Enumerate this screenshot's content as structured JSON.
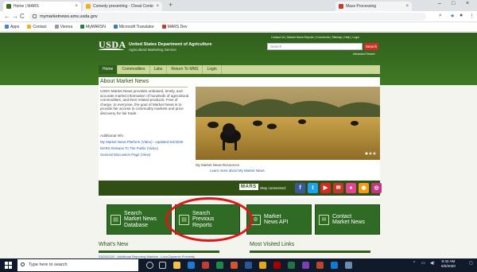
{
  "browser": {
    "tabs": [
      {
        "label": "Home | MARS",
        "close": "×"
      },
      {
        "label": "Comedy presenting - Cheat Content",
        "close": "×"
      },
      {
        "label": "Mass Processing",
        "close": "×"
      }
    ],
    "new_tab": "+",
    "window_controls": [
      "–",
      "□",
      "×"
    ],
    "nav": {
      "back": "←",
      "forward": "→",
      "reload": "C"
    },
    "url": "mymarketnews.ams.usda.gov",
    "bookmarks": [
      "Apps",
      "Contact",
      "Vienna",
      "MyMARSN",
      "Microsoft Translator",
      "MARS Dev"
    ]
  },
  "site": {
    "logo": "USDA",
    "department": "United States Department of Agriculture",
    "agency": "Agricultural Marketing Service",
    "top_links": "Contact Us | Market News Reports | Comments | Sitemap | Help | Login",
    "search_placeholder": "Search",
    "search_button": "Search",
    "advanced_search": "Advanced Search",
    "menu": [
      "Home",
      "Commodities",
      "Labs",
      "Return To MNS",
      "Login"
    ]
  },
  "about": {
    "title": "About Market News",
    "text": "USDA Market News provides unbiased, timely, and accurate market information of hundreds of agricultural commodities, and their related products. Free of charge, to everyone, the goal of Market News is to provide fair access to commodity markets and price discovery for fair trade.",
    "additional_info": "Additional Info",
    "links": [
      "My Market News Platform (Video) - Updated 5/4/2020",
      "MARS Release To The Public (Video)",
      "General Discussion Page (View)"
    ]
  },
  "hero": {
    "caption": "My Market News Resources",
    "link": "Learn more about My Market News"
  },
  "connected": {
    "mars_logo": "MARS",
    "label": "Stay connected:",
    "social": [
      {
        "name": "facebook-icon",
        "glyph": "f",
        "color": "#3b5998"
      },
      {
        "name": "twitter-icon",
        "glyph": "t",
        "color": "#1da1f2"
      },
      {
        "name": "youtube-icon",
        "glyph": "▶",
        "color": "#d62b22"
      },
      {
        "name": "email-icon",
        "glyph": "✉",
        "color": "#c0392b"
      },
      {
        "name": "flickr-icon",
        "glyph": "●",
        "color": "#e84393"
      },
      {
        "name": "rss-icon",
        "glyph": "◉",
        "color": "#f39c12"
      },
      {
        "name": "instagram-icon",
        "glyph": "◎",
        "color": "#c13584"
      }
    ]
  },
  "actions": [
    {
      "line1": "Search",
      "line2": "Market News",
      "line3": "Database",
      "icon": "▤"
    },
    {
      "line1": "Search",
      "line2": "Previous",
      "line3": "Reports",
      "icon": "▤"
    },
    {
      "line1": "Market",
      "line2": "News API",
      "line3": "",
      "icon": "⚙"
    },
    {
      "line1": "Contact",
      "line2": "Market News",
      "line3": "",
      "icon": "✉"
    }
  ],
  "sections": {
    "whats_new": "What's New",
    "most_visited": "Most Visited Links",
    "whats_new_item": "03/03/2020 · Additional Reporting Markets - Loco Dynamic Proximity"
  },
  "taskbar": {
    "search_placeholder": "Type here to search",
    "time": "9:42 AM",
    "date": "5/6/2020"
  }
}
